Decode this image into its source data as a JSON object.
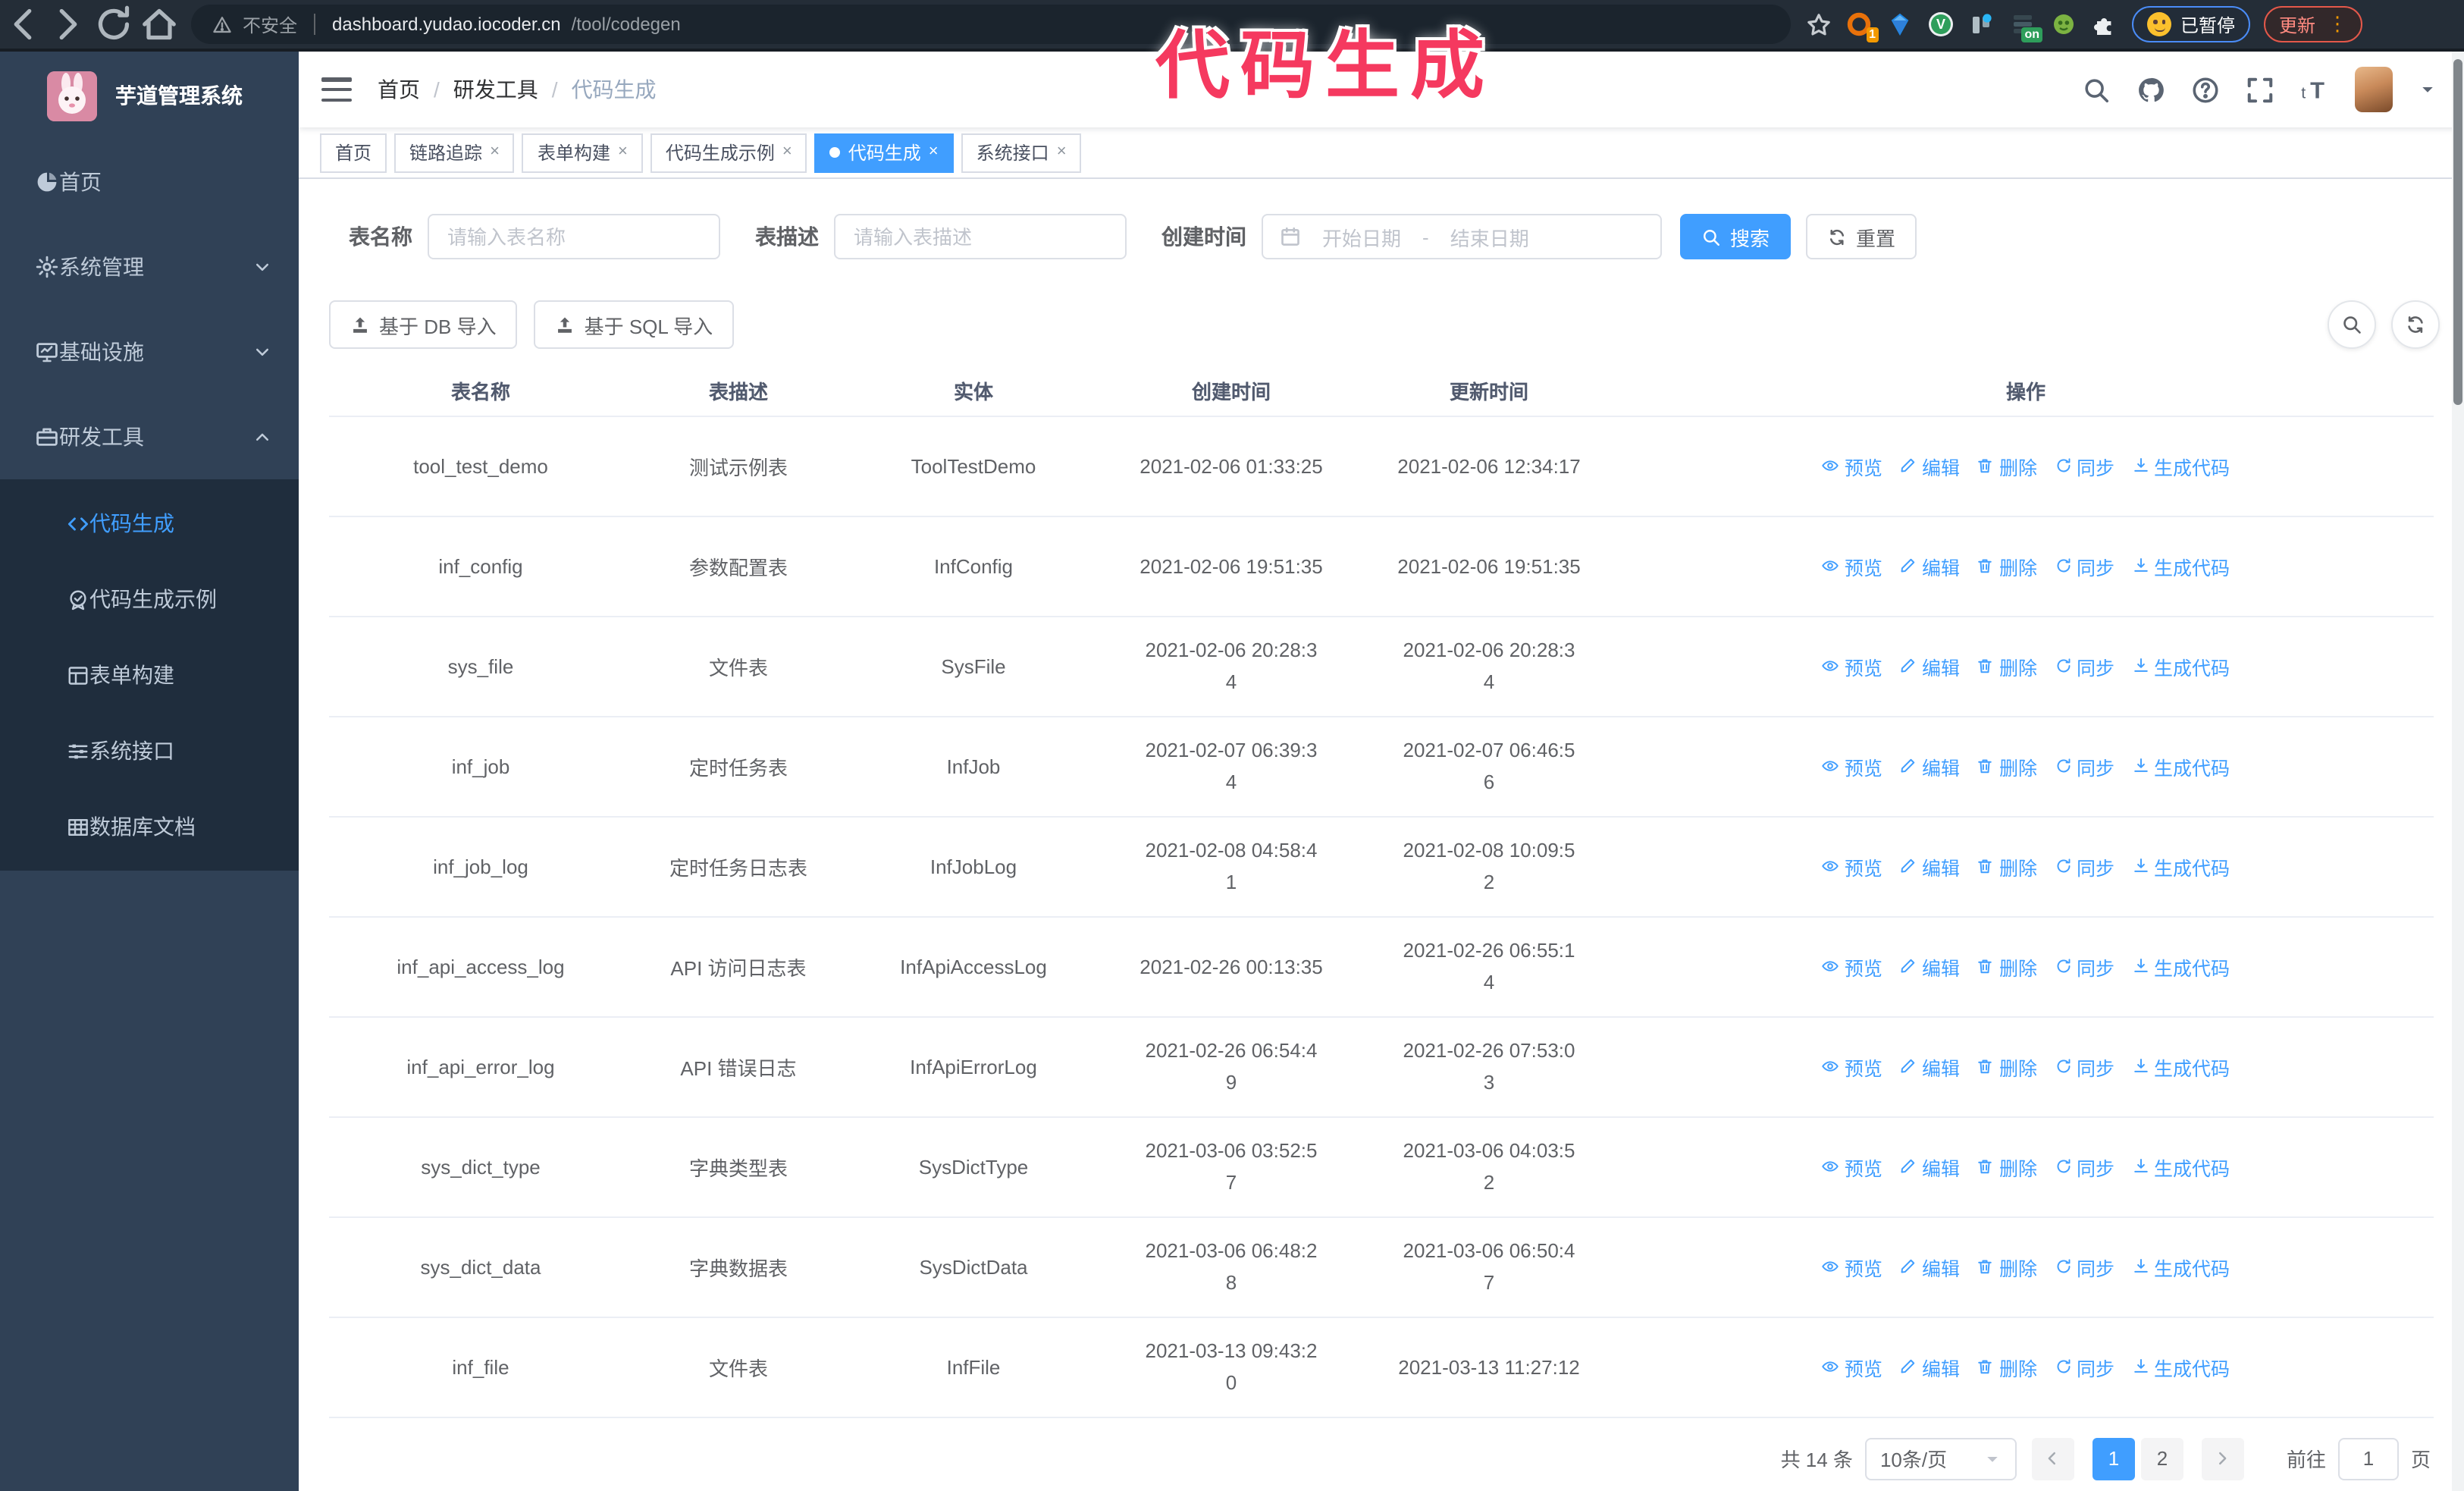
{
  "theme": {
    "accent": "#409eff",
    "sidebar_bg": "#304156",
    "submenu_bg": "#1f2d3d",
    "annotation_color": "#f5395f"
  },
  "browser": {
    "security_label": "不安全",
    "url_host": "dashboard.yudao.iocoder.cn",
    "url_path": "/tool/codegen",
    "extensions": [
      {
        "icon": "ring-icon",
        "badge": "1"
      },
      {
        "icon": "gem-icon"
      },
      {
        "icon": "circle-v-icon",
        "letter": "V"
      },
      {
        "icon": "columns-icon"
      },
      {
        "icon": "panel-icon",
        "badge": "on"
      },
      {
        "icon": "alien-icon"
      },
      {
        "icon": "puzzle-icon"
      }
    ],
    "paused_badge": "已暂停",
    "update_button": "更新"
  },
  "annotation": {
    "text": "代码生成"
  },
  "sidebar": {
    "title": "芋道管理系统",
    "items": [
      {
        "label": "首页",
        "icon": "dashboard-icon",
        "chevron": null
      },
      {
        "label": "系统管理",
        "icon": "gear-icon",
        "chevron": "down"
      },
      {
        "label": "基础设施",
        "icon": "monitor-icon",
        "chevron": "down"
      },
      {
        "label": "研发工具",
        "icon": "toolbox-icon",
        "chevron": "up"
      }
    ],
    "subitems": [
      {
        "label": "代码生成",
        "icon": "code-icon",
        "active": true
      },
      {
        "label": "代码生成示例",
        "icon": "medal-icon",
        "active": false
      },
      {
        "label": "表单构建",
        "icon": "form-icon",
        "active": false
      },
      {
        "label": "系统接口",
        "icon": "sliders-icon",
        "active": false
      },
      {
        "label": "数据库文档",
        "icon": "dbtable-icon",
        "active": false
      }
    ]
  },
  "header": {
    "breadcrumb": [
      "首页",
      "研发工具",
      "代码生成"
    ]
  },
  "tabs": [
    {
      "label": "首页",
      "closable": false,
      "active": false
    },
    {
      "label": "链路追踪",
      "closable": true,
      "active": false
    },
    {
      "label": "表单构建",
      "closable": true,
      "active": false
    },
    {
      "label": "代码生成示例",
      "closable": true,
      "active": false
    },
    {
      "label": "代码生成",
      "closable": true,
      "active": true
    },
    {
      "label": "系统接口",
      "closable": true,
      "active": false
    }
  ],
  "filters": {
    "table_name_label": "表名称",
    "table_name_placeholder": "请输入表名称",
    "table_desc_label": "表描述",
    "table_desc_placeholder": "请输入表描述",
    "create_time_label": "创建时间",
    "start_placeholder": "开始日期",
    "range_separator": "-",
    "end_placeholder": "结束日期",
    "search_label": "搜索",
    "reset_label": "重置"
  },
  "toolbar": {
    "import_db_label": "基于 DB 导入",
    "import_sql_label": "基于 SQL 导入"
  },
  "table": {
    "columns": [
      "表名称",
      "表描述",
      "实体",
      "创建时间",
      "更新时间",
      "操作"
    ],
    "action_labels": [
      "预览",
      "编辑",
      "删除",
      "同步",
      "生成代码"
    ],
    "rows": [
      {
        "name": "tool_test_demo",
        "desc": "测试示例表",
        "entity": "ToolTestDemo",
        "create_time": [
          "2021-02-06 01:33:25"
        ],
        "update_time": [
          "2021-02-06 12:34:17"
        ]
      },
      {
        "name": "inf_config",
        "desc": "参数配置表",
        "entity": "InfConfig",
        "create_time": [
          "2021-02-06 19:51:35"
        ],
        "update_time": [
          "2021-02-06 19:51:35"
        ]
      },
      {
        "name": "sys_file",
        "desc": "文件表",
        "entity": "SysFile",
        "create_time": [
          "2021-02-06 20:28:3",
          "4"
        ],
        "update_time": [
          "2021-02-06 20:28:3",
          "4"
        ]
      },
      {
        "name": "inf_job",
        "desc": "定时任务表",
        "entity": "InfJob",
        "create_time": [
          "2021-02-07 06:39:3",
          "4"
        ],
        "update_time": [
          "2021-02-07 06:46:5",
          "6"
        ]
      },
      {
        "name": "inf_job_log",
        "desc": "定时任务日志表",
        "entity": "InfJobLog",
        "create_time": [
          "2021-02-08 04:58:4",
          "1"
        ],
        "update_time": [
          "2021-02-08 10:09:5",
          "2"
        ]
      },
      {
        "name": "inf_api_access_log",
        "desc": "API 访问日志表",
        "entity": "InfApiAccessLog",
        "create_time": [
          "2021-02-26 00:13:35"
        ],
        "update_time": [
          "2021-02-26 06:55:1",
          "4"
        ]
      },
      {
        "name": "inf_api_error_log",
        "desc": "API 错误日志",
        "entity": "InfApiErrorLog",
        "create_time": [
          "2021-02-26 06:54:4",
          "9"
        ],
        "update_time": [
          "2021-02-26 07:53:0",
          "3"
        ]
      },
      {
        "name": "sys_dict_type",
        "desc": "字典类型表",
        "entity": "SysDictType",
        "create_time": [
          "2021-03-06 03:52:5",
          "7"
        ],
        "update_time": [
          "2021-03-06 04:03:5",
          "2"
        ]
      },
      {
        "name": "sys_dict_data",
        "desc": "字典数据表",
        "entity": "SysDictData",
        "create_time": [
          "2021-03-06 06:48:2",
          "8"
        ],
        "update_time": [
          "2021-03-06 06:50:4",
          "7"
        ]
      },
      {
        "name": "inf_file",
        "desc": "文件表",
        "entity": "InfFile",
        "create_time": [
          "2021-03-13 09:43:2",
          "0"
        ],
        "update_time": [
          "2021-03-13 11:27:12"
        ]
      }
    ]
  },
  "pagination": {
    "total_text": "共 14 条",
    "page_size": "10条/页",
    "pages": [
      "1",
      "2"
    ],
    "active_page": "1",
    "goto_label": "前往",
    "goto_value": "1",
    "goto_suffix": "页"
  }
}
